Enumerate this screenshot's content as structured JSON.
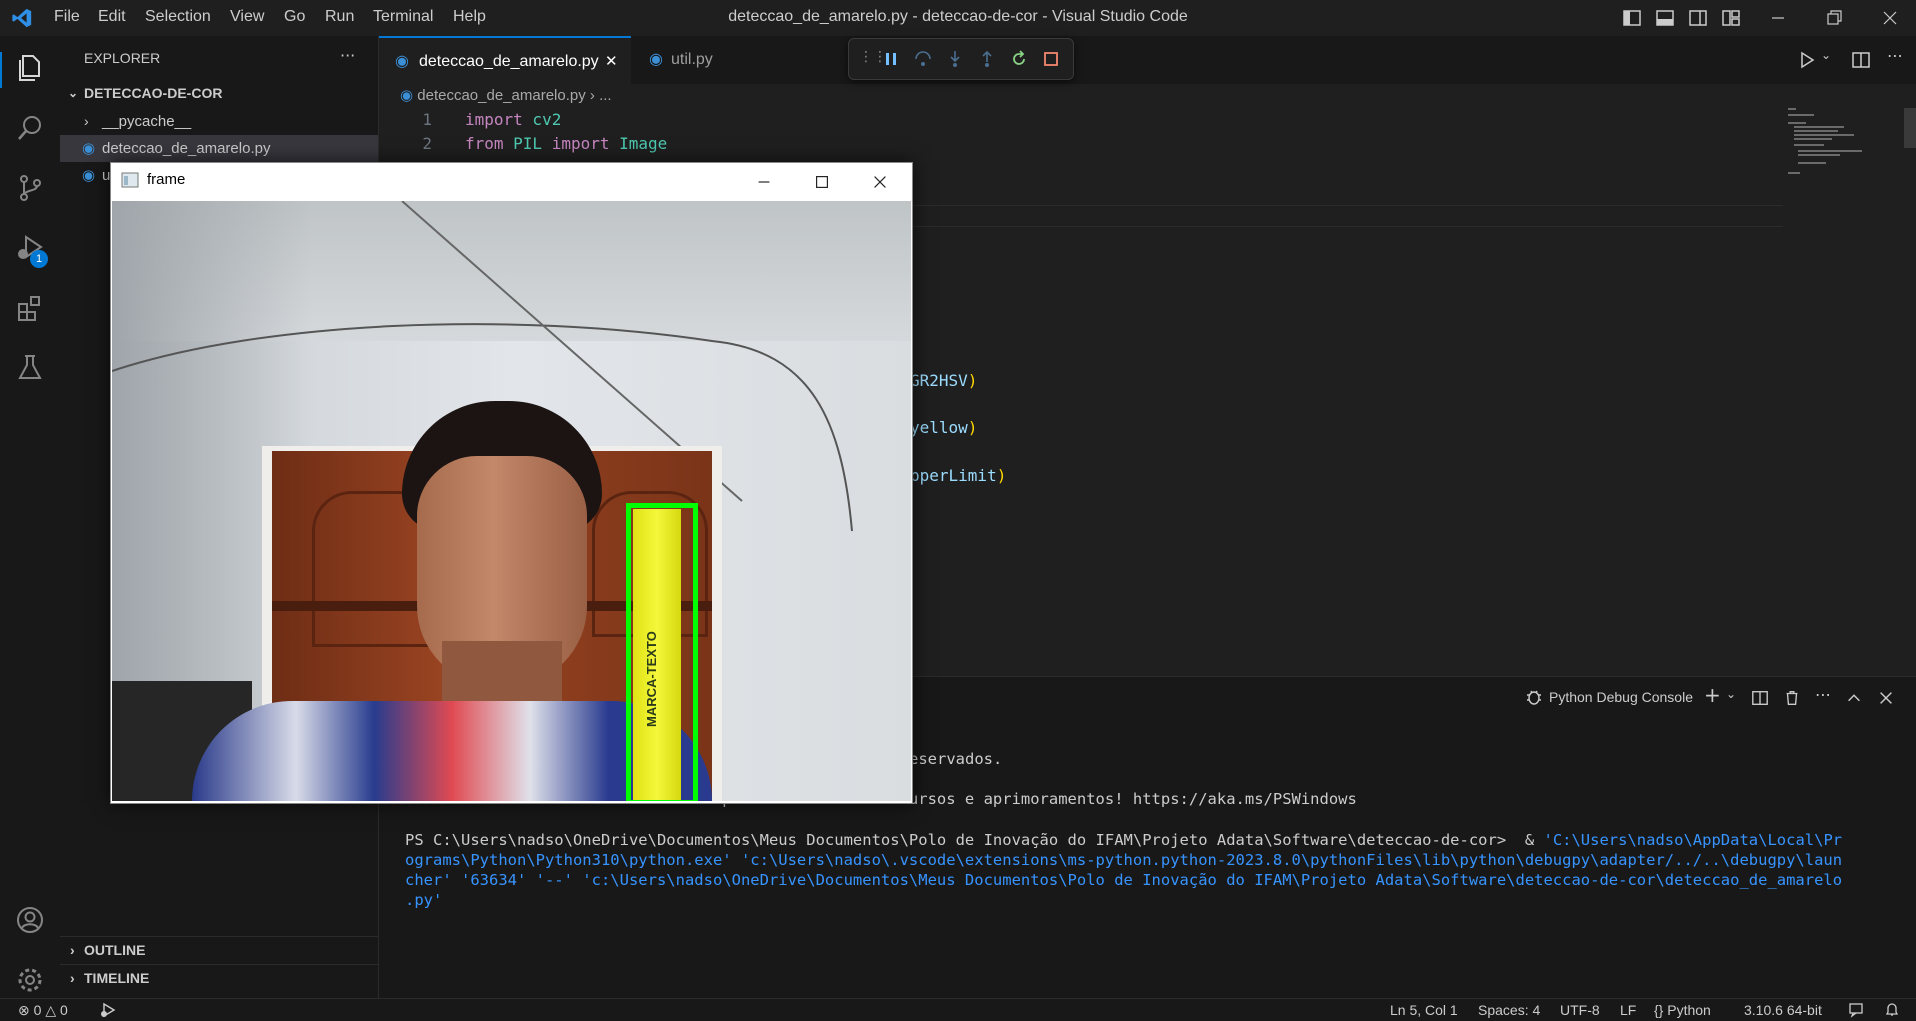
{
  "menu": [
    "File",
    "Edit",
    "Selection",
    "View",
    "Go",
    "Run",
    "Terminal",
    "Help"
  ],
  "window_title": "deteccao_de_amarelo.py - deteccao-de-cor - Visual Studio Code",
  "activity": {
    "debug_badge": "1"
  },
  "explorer": {
    "header": "EXPLORER",
    "more": "···",
    "root": "DETECCAO-DE-COR",
    "items": [
      {
        "label": "__pycache__"
      },
      {
        "label": "deteccao_de_amarelo.py"
      },
      {
        "label": "u"
      }
    ],
    "outline": "OUTLINE",
    "timeline": "TIMELINE"
  },
  "tabs": [
    {
      "label": "deteccao_de_amarelo.py",
      "close": "✕"
    },
    {
      "label": "util.py"
    }
  ],
  "breadcrumb": {
    "file": "deteccao_de_amarelo.py",
    "sep": "›",
    "rest": "..."
  },
  "code": {
    "lines": [
      {
        "num": "1",
        "kw": "import",
        "mod": " cv2"
      },
      {
        "num": "2",
        "kw": "from",
        "mod": " PIL",
        "kw2": " import",
        "id": " Image"
      }
    ],
    "frag1": {
      "text": "GR2HSV",
      "close": ")"
    },
    "frag2": {
      "text": "yellow",
      "close": ")"
    },
    "frag3": {
      "text": "pperLimit",
      "close": ")"
    }
  },
  "panel": {
    "console_label": "Python Debug Console",
    "partial_copyright": "eservados.",
    "partial_install": "Instale o PowerShell mais recente para obter novos recursos e aprimoramentos! https://aka.ms/PSWindows",
    "prompt": "PS C:\\Users\\nadso\\OneDrive\\Documentos\\Meus Documentos\\Polo de Inovação do IFAM\\Projeto Adata\\Software\\deteccao-de-cor>  & ",
    "cmd1": "'C:\\Users\\nadso\\AppData\\Local\\Pr",
    "cmd2": "ograms\\Python\\Python310\\python.exe' 'c:\\Users\\nadso\\.vscode\\extensions\\ms-python.python-2023.8.0\\pythonFiles\\lib\\python\\debugpy\\adapter/../..\\debugpy\\laun",
    "cmd3": "cher' '63634' '--' 'c:\\Users\\nadso\\OneDrive\\Documentos\\Meus Documentos\\Polo de Inovação do IFAM\\Projeto Adata\\Software\\deteccao-de-cor\\deteccao_de_amarelo",
    "cmd4": ".py'"
  },
  "frame_window": {
    "title": "frame",
    "marker_text": "MARCA-TEXTO"
  },
  "status": {
    "errors": "0",
    "warnings": "0",
    "position": "Ln 5, Col 1",
    "spaces": "Spaces: 4",
    "encoding": "UTF-8",
    "eol": "LF",
    "language": "Python",
    "interpreter": "3.10.6 64-bit"
  },
  "colors": {
    "accent": "#0078d4",
    "detection_box": "#00ff00",
    "highlighter": "#f1f51a"
  }
}
